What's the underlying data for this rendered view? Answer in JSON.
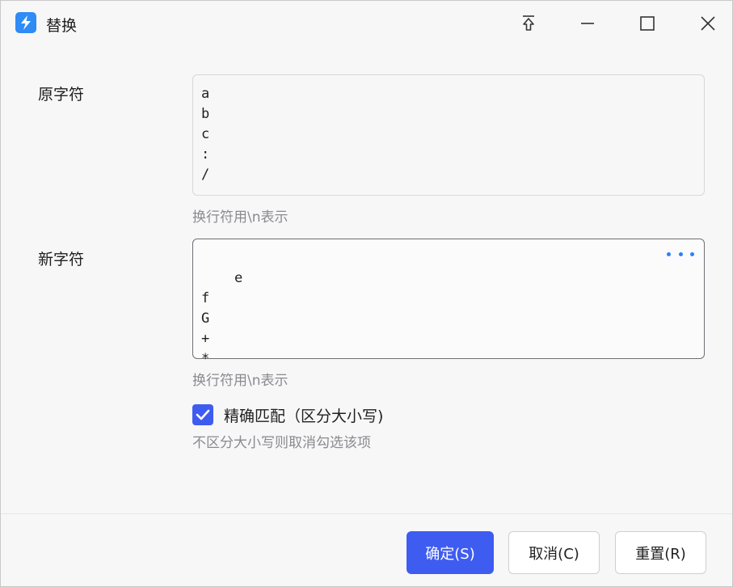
{
  "window": {
    "title": "替换",
    "icons": {
      "app": "app-logo-icon",
      "pin": "pin-to-top-icon",
      "minimize": "minimize-icon",
      "maximize": "maximize-icon",
      "close": "close-icon"
    }
  },
  "original": {
    "label": "原字符",
    "value": "a\nb\nc\n:\n/",
    "hint": "换行符用\\n表示"
  },
  "replacement": {
    "label": "新字符",
    "value": "e\nf\nG\n+\n*",
    "hint": "换行符用\\n表示",
    "more_icon": "more-dots-icon"
  },
  "exact_match": {
    "checked": true,
    "label": "精确匹配（区分大小写)",
    "hint": "不区分大小写则取消勾选该项"
  },
  "buttons": {
    "confirm": "确定(S)",
    "cancel": "取消(C)",
    "reset": "重置(R)"
  },
  "colors": {
    "accent": "#3f5cf1",
    "link": "#2f7ff5",
    "app_icon": "#2f8bf5"
  }
}
